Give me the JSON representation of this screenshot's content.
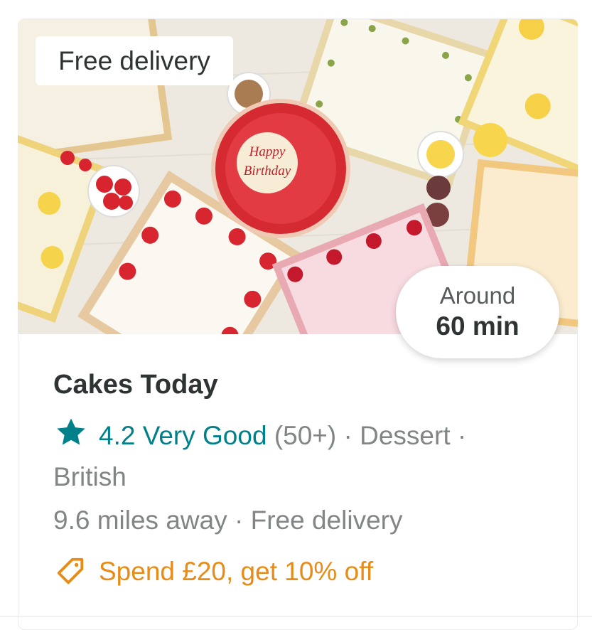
{
  "restaurant": {
    "name": "Cakes Today",
    "rating": "4.2 Very Good",
    "review_count": "(50+)",
    "separator": "·",
    "cuisines": [
      "Dessert",
      "British"
    ],
    "distance": "9.6 miles away",
    "delivery": "Free delivery",
    "offer": "Spend £20, get 10% off"
  },
  "hero": {
    "badge": "Free delivery",
    "cake_text_line1": "Happy",
    "cake_text_line2": "Birthday"
  },
  "eta": {
    "label": "Around",
    "value": "60 min"
  },
  "icons": {
    "rating": "star-icon",
    "offer": "tag-icon"
  },
  "colors": {
    "rating": "#00808a",
    "offer": "#e88b17",
    "text_primary": "#2e3333",
    "text_secondary": "#828585"
  }
}
